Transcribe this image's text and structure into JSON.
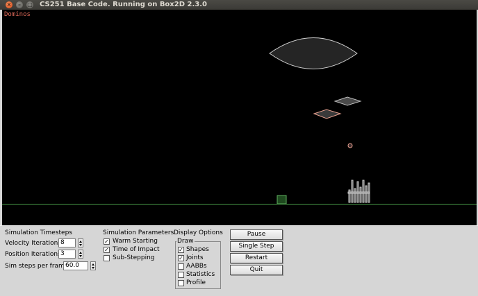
{
  "window": {
    "title": "CS251 Base Code. Running on Box2D 2.3.0",
    "close_glyph": "×",
    "min_glyph": "–",
    "max_glyph": "□"
  },
  "canvas": {
    "test_name": "Dominos",
    "background": "#000000",
    "ground_color": "#4a9e4a",
    "shape_outline_color": "#d0d0d0",
    "highlight_color": "#e7a08f"
  },
  "timesteps": {
    "heading": "Simulation Timesteps",
    "velocity_label": "Velocity Iterations",
    "velocity_value": "8",
    "position_label": "Position Iterations",
    "position_value": "3",
    "steps_label": "Sim steps per frame",
    "steps_value": "60.0"
  },
  "params": {
    "heading": "Simulation Parameters",
    "items": [
      {
        "label": "Warm Starting",
        "checked": true
      },
      {
        "label": "Time of Impact",
        "checked": true
      },
      {
        "label": "Sub-Stepping",
        "checked": false
      }
    ]
  },
  "display": {
    "heading": "Display Options",
    "group_label": "Draw",
    "items": [
      {
        "label": "Shapes",
        "checked": true
      },
      {
        "label": "Joints",
        "checked": true
      },
      {
        "label": "AABBs",
        "checked": false
      },
      {
        "label": "Statistics",
        "checked": false
      },
      {
        "label": "Profile",
        "checked": false
      }
    ]
  },
  "buttons": {
    "pause": "Pause",
    "single_step": "Single Step",
    "restart": "Restart",
    "quit": "Quit"
  },
  "check_glyph": "✓"
}
